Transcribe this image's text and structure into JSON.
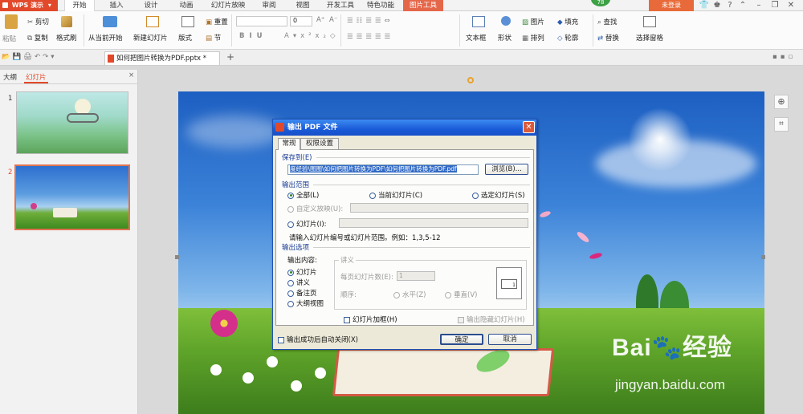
{
  "app": {
    "logo": "WPS 演示",
    "login": "未登录",
    "badge": "78"
  },
  "tabs": [
    "开始",
    "插入",
    "设计",
    "动画",
    "幻灯片放映",
    "审阅",
    "视图",
    "开发工具",
    "特色功能",
    "图片工具"
  ],
  "ribbon": {
    "paste": "粘贴",
    "cut": "剪切",
    "copy": "复制",
    "format_painter": "格式刷",
    "from_current": "从当前开始",
    "new_slide": "新建幻灯片",
    "layout": "版式",
    "reset": "重置",
    "section": "节",
    "font_size": "0",
    "text_box": "文本框",
    "shape": "形状",
    "picture": "图片",
    "fill": "填充",
    "arrange": "排列",
    "outline": "轮廓",
    "find": "查找",
    "replace": "替换",
    "select_pane": "选择窗格"
  },
  "document": {
    "tab_title": "如何把图片转换为PDF.pptx *"
  },
  "left_panel": {
    "tab_outline": "大纲",
    "tab_slides": "幻灯片",
    "slide_numbers": [
      "1",
      "2"
    ]
  },
  "dialog": {
    "title": "输出 PDF 文件",
    "tab_general": "常规",
    "tab_permissions": "权限设置",
    "save_to_label": "保存到(E)",
    "save_path": "度经验\\图图\\如何把图片转换为PDF\\如何把图片转换为PDF.pdf",
    "browse": "浏览(B)...",
    "range_label": "输出范围",
    "range_all": "全部(L)",
    "range_current": "当前幻灯片(C)",
    "range_selected": "选定幻灯片(S)",
    "custom_show": "自定义放映(U):",
    "slides_radio": "幻灯片(I):",
    "slides_hint": "请输入幻灯片编号或幻灯片范围。例如：1,3,5-12",
    "options_label": "输出选项",
    "content_label": "输出内容:",
    "content_slides": "幻灯片",
    "content_handouts": "讲义",
    "content_notes": "备注页",
    "content_outline": "大纲视图",
    "handout_group": "讲义",
    "per_page_label": "每页幻灯片数(E):",
    "per_page_value": "1",
    "order_label": "顺序:",
    "order_horizontal": "水平(Z)",
    "order_vertical": "垂直(V)",
    "frame_slides": "幻灯片加框(H)",
    "hidden_slides": "输出隐藏幻灯片(H)",
    "auto_close": "输出成功后自动关闭(X)",
    "ok": "确定",
    "cancel": "取消",
    "preview_number": "1"
  },
  "watermark": {
    "brand_line1": "Bai",
    "brand_line1_b": "经验",
    "brand_line2": "jingyan.baidu.com"
  },
  "colors": {
    "accent": "#e2492b",
    "dialog_title": "#1a5bd8",
    "dialog_bg": "#ece9d8",
    "selection": "#316ac5"
  }
}
